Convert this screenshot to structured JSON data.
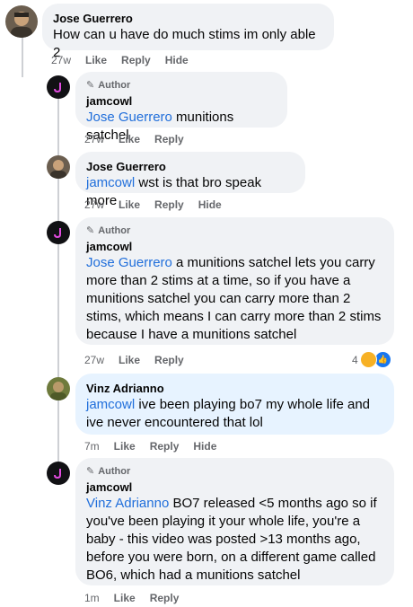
{
  "comments": [
    {
      "name": "Jose Guerrero",
      "text": "How can u have do much stims im only able 2",
      "time": "27w",
      "like": "Like",
      "reply": "Reply",
      "hide": "Hide"
    },
    {
      "author_badge": "Author",
      "name": "jamcowl",
      "mention": "Jose Guerrero",
      "text": " munitions satchel",
      "time": "27w",
      "like": "Like",
      "reply": "Reply"
    },
    {
      "name": "Jose Guerrero",
      "mention": "jamcowl",
      "text": " wst is that bro speak more",
      "time": "27w",
      "like": "Like",
      "reply": "Reply",
      "hide": "Hide"
    },
    {
      "author_badge": "Author",
      "name": "jamcowl",
      "mention": "Jose Guerrero",
      "text": " a munitions satchel lets you carry more than 2 stims at a time, so if you have a munitions satchel you can carry more than 2 stims, which means I can carry more than 2 stims because I have a munitions satchel",
      "time": "27w",
      "like": "Like",
      "reply": "Reply",
      "reaction_count": "4"
    },
    {
      "name": "Vinz Adrianno",
      "mention": "jamcowl",
      "text": " ive been playing bo7 my whole life and ive never encountered that lol",
      "time": "7m",
      "like": "Like",
      "reply": "Reply",
      "hide": "Hide"
    },
    {
      "author_badge": "Author",
      "name": "jamcowl",
      "mention": "Vinz Adrianno",
      "text": " BO7 released <5 months ago so if you've been playing it your whole life, you're a baby - this video was posted >13 months ago, before you were born, on a different game called BO6, which had a munitions satchel",
      "time": "1m",
      "like": "Like",
      "reply": "Reply"
    }
  ],
  "colors": {
    "bubble": "#f0f2f5",
    "highlight": "#e7f3ff",
    "mention": "#216fdb",
    "meta": "#65676b"
  }
}
